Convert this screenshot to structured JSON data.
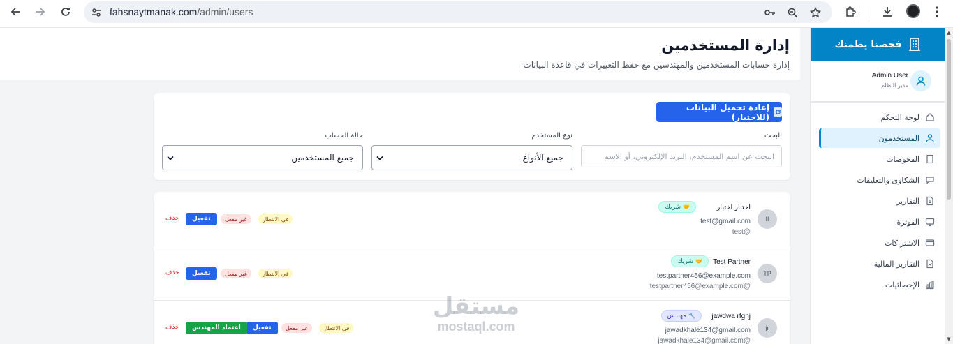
{
  "browser": {
    "url_domain": "fahsnaytmanak.com",
    "url_path": "/admin/users"
  },
  "header": {
    "title": "إدارة المستخدمين",
    "subtitle": "إدارة حسابات المستخدمين والمهندسين مع حفظ التغييرات في قاعدة البيانات"
  },
  "sidebar": {
    "brand": "فحصنا يطمنك",
    "user_name": "Admin User",
    "user_role": "مدير النظام",
    "items": [
      {
        "label": "لوحة التحكم",
        "icon": "home-icon"
      },
      {
        "label": "المستخدمون",
        "icon": "user-icon",
        "active": true
      },
      {
        "label": "الفحوصات",
        "icon": "building-icon"
      },
      {
        "label": "الشكاوى والتعليقات",
        "icon": "chat-icon"
      },
      {
        "label": "التقارير",
        "icon": "document-icon"
      },
      {
        "label": "الفوترة",
        "icon": "monitor-icon"
      },
      {
        "label": "الاشتراكات",
        "icon": "card-icon"
      },
      {
        "label": "التقارير المالية",
        "icon": "chart-file-icon"
      },
      {
        "label": "الإحصائيات",
        "icon": "bar-chart-icon"
      }
    ]
  },
  "filters": {
    "reload_label": "إعادة تحميل البيانات (للاختبار)",
    "search_label": "البحث",
    "search_placeholder": "البحث عن اسم المستخدم، البريد الإلكتروني، أو الاسم",
    "type_label": "نوع المستخدم",
    "type_value": "جميع الأنواع",
    "status_label": "حالة الحساب",
    "status_value": "جميع المستخدمين"
  },
  "users": [
    {
      "initials": "II",
      "name": "اختبار اختبار",
      "type": "شريك",
      "email": "test@gmail.com",
      "username": "test@",
      "status_pending": "في الانتظار",
      "status_inactive": "غير مفعل",
      "activate_label": "تفعيل",
      "delete_label": "حذف"
    },
    {
      "initials": "TP",
      "name": "Test Partner",
      "type": "شريك",
      "email": "testpartner456@example.com",
      "username": "testpartner456@example.com@",
      "status_pending": "في الانتظار",
      "status_inactive": "غير مفعل",
      "activate_label": "تفعيل",
      "delete_label": "حذف"
    },
    {
      "initials": "jr",
      "name": "jawdwa rfghj",
      "type": "مهندس",
      "email": "jawadkhale134@gmail.com",
      "username": "jawadkhale134@gmail.com@",
      "status_pending": "في الانتظار",
      "status_inactive": "غير مفعل",
      "activate_label": "تفعيل",
      "approve_label": "اعتماد المهندس",
      "delete_label": "حذف"
    }
  ],
  "watermark": {
    "arabic": "مستقل",
    "latin": "mostaql.com"
  },
  "colors": {
    "brand": "#0284c7",
    "primary": "#2563eb",
    "success": "#16a34a",
    "danger": "#dc2626"
  }
}
